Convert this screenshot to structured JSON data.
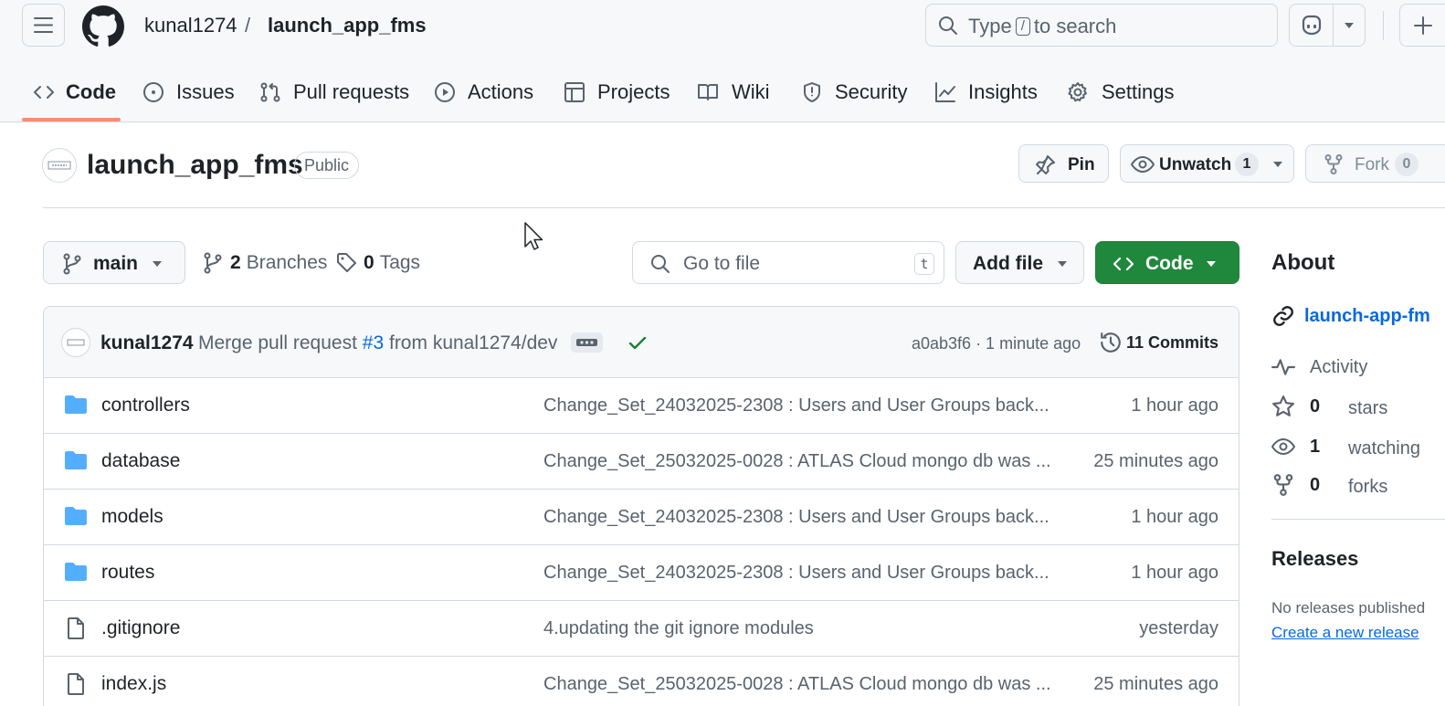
{
  "header": {
    "owner": "kunal1274",
    "separator": "/",
    "repo": "launch_app_fms",
    "search": {
      "prefix": "Type",
      "key": "/",
      "suffix": "to search"
    },
    "tabs": [
      {
        "label": "Code",
        "icon": "code-icon",
        "selected": true
      },
      {
        "label": "Issues",
        "icon": "issue-icon"
      },
      {
        "label": "Pull requests",
        "icon": "pull-request-icon"
      },
      {
        "label": "Actions",
        "icon": "play-icon"
      },
      {
        "label": "Projects",
        "icon": "table-icon"
      },
      {
        "label": "Wiki",
        "icon": "book-icon"
      },
      {
        "label": "Security",
        "icon": "shield-icon"
      },
      {
        "label": "Insights",
        "icon": "graph-icon"
      },
      {
        "label": "Settings",
        "icon": "gear-icon"
      }
    ]
  },
  "repo_header": {
    "name": "launch_app_fms",
    "visibility": "Public",
    "pin_label": "Pin",
    "unwatch_label": "Unwatch",
    "watch_count": "1",
    "fork_label": "Fork",
    "fork_count": "0"
  },
  "controls": {
    "branch": "main",
    "branches_count": "2",
    "branches_label": "Branches",
    "tags_count": "0",
    "tags_label": "Tags",
    "go_to_file_placeholder": "Go to file",
    "go_to_file_key": "t",
    "add_file_label": "Add file",
    "code_label": "Code"
  },
  "latest_commit": {
    "author": "kunal1274",
    "message_prefix": "Merge pull request",
    "pr_link": "#3",
    "message_suffix": "from kunal1274/dev",
    "hash_time": "a0ab3f6 · 1 minute ago",
    "commits_label": "11 Commits"
  },
  "files": [
    {
      "type": "folder",
      "name": "controllers",
      "message": "Change_Set_24032025-2308 : Users and User Groups back...",
      "time": "1 hour ago"
    },
    {
      "type": "folder",
      "name": "database",
      "message": "Change_Set_25032025-0028 : ATLAS Cloud mongo db was ...",
      "time": "25 minutes ago"
    },
    {
      "type": "folder",
      "name": "models",
      "message": "Change_Set_24032025-2308 : Users and User Groups back...",
      "time": "1 hour ago"
    },
    {
      "type": "folder",
      "name": "routes",
      "message": "Change_Set_24032025-2308 : Users and User Groups back...",
      "time": "1 hour ago"
    },
    {
      "type": "file",
      "name": ".gitignore",
      "message": "4.updating the git ignore modules",
      "time": "yesterday"
    },
    {
      "type": "file",
      "name": "index.js",
      "message": "Change_Set_25032025-0028 : ATLAS Cloud mongo db was ...",
      "time": "25 minutes ago"
    }
  ],
  "sidebar": {
    "about_title": "About",
    "link": "launch-app-fm",
    "activity_label": "Activity",
    "stars_count": "0",
    "stars_label": "stars",
    "watching_count": "1",
    "watching_label": "watching",
    "forks_count": "0",
    "forks_label": "forks",
    "releases_title": "Releases",
    "releases_text": "No releases published",
    "create_release": "Create a new release"
  },
  "colors": {
    "accent": "#0969da",
    "green": "#1f883d",
    "tab_underline": "#fd8c73",
    "folder": "#54aeff"
  }
}
